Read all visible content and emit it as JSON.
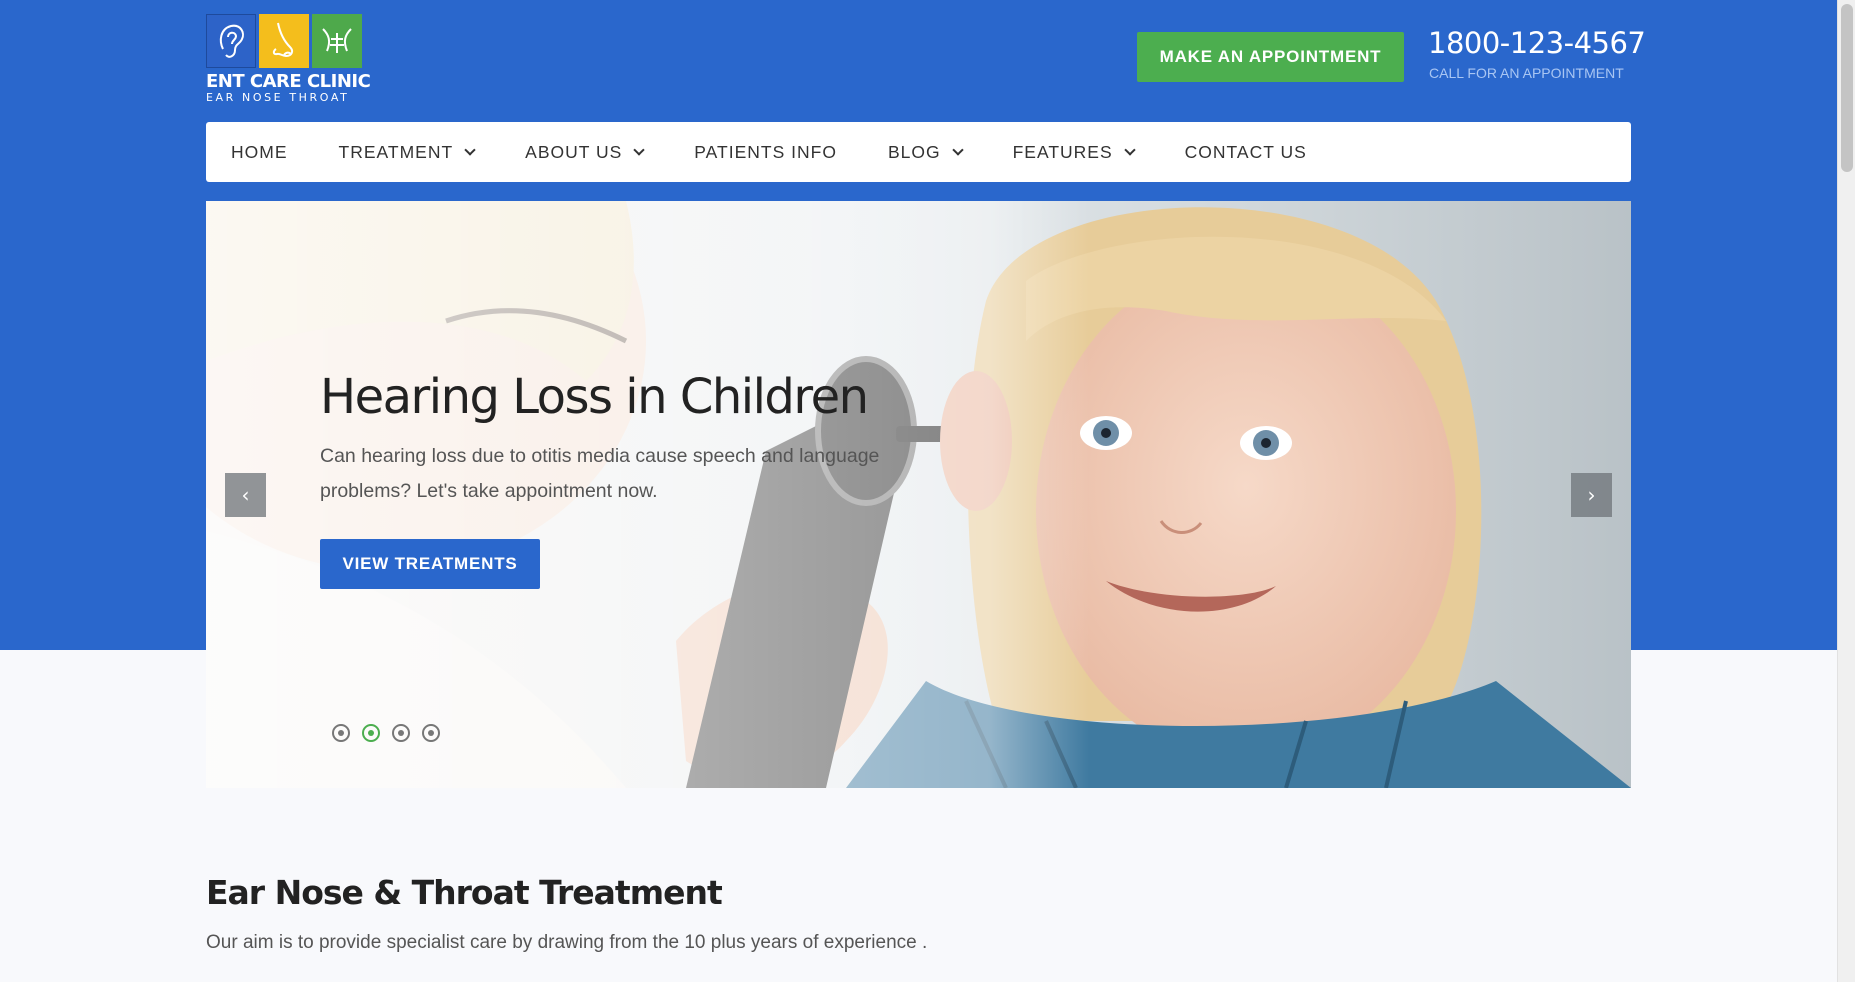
{
  "logo": {
    "name": "ENT CARE CLINIC",
    "tagline": "EAR NOSE THROAT",
    "tiles": [
      "ear-icon",
      "nose-icon",
      "throat-icon"
    ]
  },
  "header": {
    "appointment_label": "MAKE AN APPOINTMENT",
    "phone": "1800-123-4567",
    "phone_caption": "CALL FOR AN APPOINTMENT"
  },
  "nav": {
    "items": [
      {
        "label": "HOME",
        "dropdown": false
      },
      {
        "label": "TREATMENT",
        "dropdown": true
      },
      {
        "label": "ABOUT US",
        "dropdown": true
      },
      {
        "label": "PATIENTS INFO",
        "dropdown": false
      },
      {
        "label": "BLOG",
        "dropdown": true
      },
      {
        "label": "FEATURES",
        "dropdown": true
      },
      {
        "label": "CONTACT US",
        "dropdown": false
      }
    ]
  },
  "hero": {
    "title": "Hearing Loss in Children",
    "text": "Can hearing loss due to otitis media cause speech and language problems? Let's take appointment now.",
    "button_label": "VIEW TREATMENTS",
    "prev_icon": "‹",
    "next_icon": "›",
    "slide_count": 4,
    "active_slide": 2
  },
  "section": {
    "title": "Ear Nose & Throat Treatment",
    "text": "Our aim is to provide specialist care by drawing from the 10 plus years of experience ."
  },
  "colors": {
    "brand_blue": "#2a67cc",
    "accent_green": "#4cae4f",
    "accent_yellow": "#f4be1c",
    "page_bg": "#f8f9fc"
  }
}
